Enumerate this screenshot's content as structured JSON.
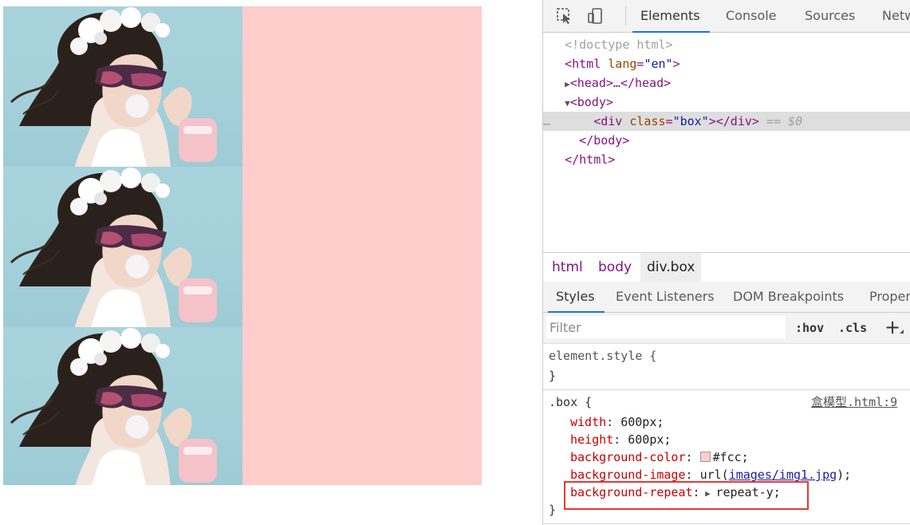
{
  "colors": {
    "box_bg": "#fcc",
    "accent": "#1a73e8",
    "highlight": "#e53935"
  },
  "toolbar": {
    "inspect_icon": "select-element-icon",
    "device_icon": "device-toolbar-icon",
    "tabs": [
      "Elements",
      "Console",
      "Sources",
      "Netw"
    ]
  },
  "dom": {
    "doctype": "<!doctype html>",
    "html_open_tag": "<html",
    "html_attr": "lang",
    "html_attr_val": "\"en\"",
    "html_close_bracket": ">",
    "head_collapsed": "<head>…</head>",
    "body_open": "<body>",
    "div_open": "<div",
    "div_attr": "class",
    "div_attr_val": "\"box\"",
    "div_close": "></div>",
    "selected_marker": "== $0",
    "ellipsis": "…",
    "body_close": "</body>",
    "html_close": "</html>"
  },
  "breadcrumbs": [
    "html",
    "body",
    "div.box"
  ],
  "subtabs": [
    "Styles",
    "Event Listeners",
    "DOM Breakpoints",
    "Proper"
  ],
  "filter": {
    "placeholder": "Filter",
    "hov": ":hov",
    "cls": ".cls",
    "add": "+"
  },
  "styles": {
    "element_style_selector": "element.style {",
    "element_style_close": "}",
    "box_selector": ".box {",
    "source_link": "盒模型.html:9",
    "box_close": "}",
    "props": [
      {
        "name": "width",
        "value": "600px;"
      },
      {
        "name": "height",
        "value": "600px;"
      },
      {
        "name": "background-color",
        "value": "#fcc;"
      },
      {
        "name": "background-image",
        "value_prefix": "url(",
        "value_link": "images/img1.jpg",
        "value_suffix": ");"
      },
      {
        "name": "background-repeat",
        "value": "repeat-y;"
      }
    ]
  }
}
